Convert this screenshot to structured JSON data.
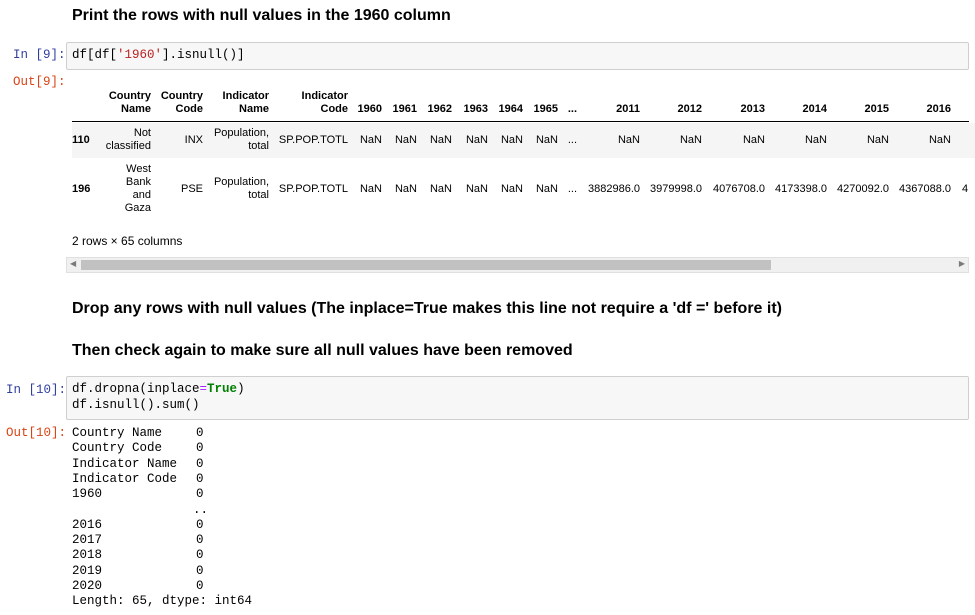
{
  "cell_md_1": {
    "heading": "Print the rows with null values in the 1960 column"
  },
  "cell_9": {
    "in_prompt": "In [9]:",
    "out_prompt": "Out[9]:",
    "code": {
      "a": "df[df[",
      "b": "'1960'",
      "c": "].isnull()]"
    },
    "table": {
      "headers": [
        [
          "Country",
          "Name"
        ],
        [
          "Country",
          "Code"
        ],
        [
          "Indicator",
          "Name"
        ],
        [
          "Indicator",
          "Code"
        ],
        [
          "1960"
        ],
        [
          "1961"
        ],
        [
          "1962"
        ],
        [
          "1963"
        ],
        [
          "1964"
        ],
        [
          "1965"
        ],
        [
          "..."
        ],
        [
          "2011"
        ],
        [
          "2012"
        ],
        [
          "2013"
        ],
        [
          "2014"
        ],
        [
          "2015"
        ],
        [
          "2016"
        ]
      ],
      "rows": [
        {
          "index": "110",
          "cells": [
            [
              "Not",
              "classified"
            ],
            [
              "INX"
            ],
            [
              "Population,",
              "total"
            ],
            [
              "SP.POP.TOTL"
            ],
            [
              "NaN"
            ],
            [
              "NaN"
            ],
            [
              "NaN"
            ],
            [
              "NaN"
            ],
            [
              "NaN"
            ],
            [
              "NaN"
            ],
            [
              "..."
            ],
            [
              "NaN"
            ],
            [
              "NaN"
            ],
            [
              "NaN"
            ],
            [
              "NaN"
            ],
            [
              "NaN"
            ],
            [
              "NaN"
            ]
          ]
        },
        {
          "index": "196",
          "cells": [
            [
              "West",
              "Bank",
              "and",
              "Gaza"
            ],
            [
              "PSE"
            ],
            [
              "Population,",
              "total"
            ],
            [
              "SP.POP.TOTL"
            ],
            [
              "NaN"
            ],
            [
              "NaN"
            ],
            [
              "NaN"
            ],
            [
              "NaN"
            ],
            [
              "NaN"
            ],
            [
              "NaN"
            ],
            [
              "..."
            ],
            [
              "3882986.0"
            ],
            [
              "3979998.0"
            ],
            [
              "4076708.0"
            ],
            [
              "4173398.0"
            ],
            [
              "4270092.0"
            ],
            [
              "4367088.0"
            ]
          ],
          "clipped": "4"
        }
      ],
      "shape_note": "2 rows × 65 columns"
    },
    "scrollbar": {
      "left_arrow": "◀",
      "right_arrow": "▶"
    }
  },
  "cell_md_2": {
    "heading1": "Drop any rows with null values (The inplace=True makes this line not require a 'df =' before it)",
    "heading2": "Then check again to make sure all null values have been removed"
  },
  "cell_10": {
    "in_prompt": "In [10]:",
    "out_prompt": "Out[10]:",
    "code_line1": {
      "a": "df.dropna(inplace",
      "op": "=",
      "kw": "True",
      "b": ")"
    },
    "code_line2": "df.isnull().sum()",
    "output": [
      {
        "name": "Country Name",
        "value": "0"
      },
      {
        "name": "Country Code",
        "value": "0"
      },
      {
        "name": "Indicator Name",
        "value": "0"
      },
      {
        "name": "Indicator Code",
        "value": "0"
      },
      {
        "name": "1960",
        "value": "0"
      },
      {
        "name": "",
        "value": ".."
      },
      {
        "name": "2016",
        "value": "0"
      },
      {
        "name": "2017",
        "value": "0"
      },
      {
        "name": "2018",
        "value": "0"
      },
      {
        "name": "2019",
        "value": "0"
      },
      {
        "name": "2020",
        "value": "0"
      }
    ],
    "footer": "Length: 65, dtype: int64"
  }
}
